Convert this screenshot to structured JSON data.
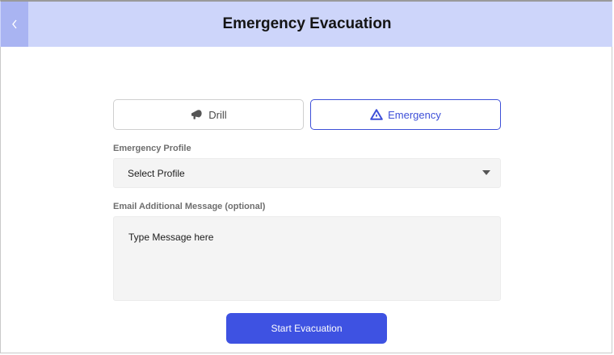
{
  "header": {
    "title": "Emergency Evacuation",
    "back_icon": "chevron-left-icon"
  },
  "mode": {
    "drill_label": "Drill",
    "drill_icon": "megaphone-icon",
    "emergency_label": "Emergency",
    "emergency_icon": "warning-triangle-icon",
    "selected": "Emergency"
  },
  "profile": {
    "label": "Emergency Profile",
    "selected_value": "Select Profile"
  },
  "message": {
    "label": "Email Additional Message (optional)",
    "placeholder": "Type Message here"
  },
  "actions": {
    "start_label": "Start Evacuation"
  },
  "colors": {
    "header_bg": "#cdd5fa",
    "back_bg": "#a9b4f2",
    "accent": "#3e52e2"
  }
}
